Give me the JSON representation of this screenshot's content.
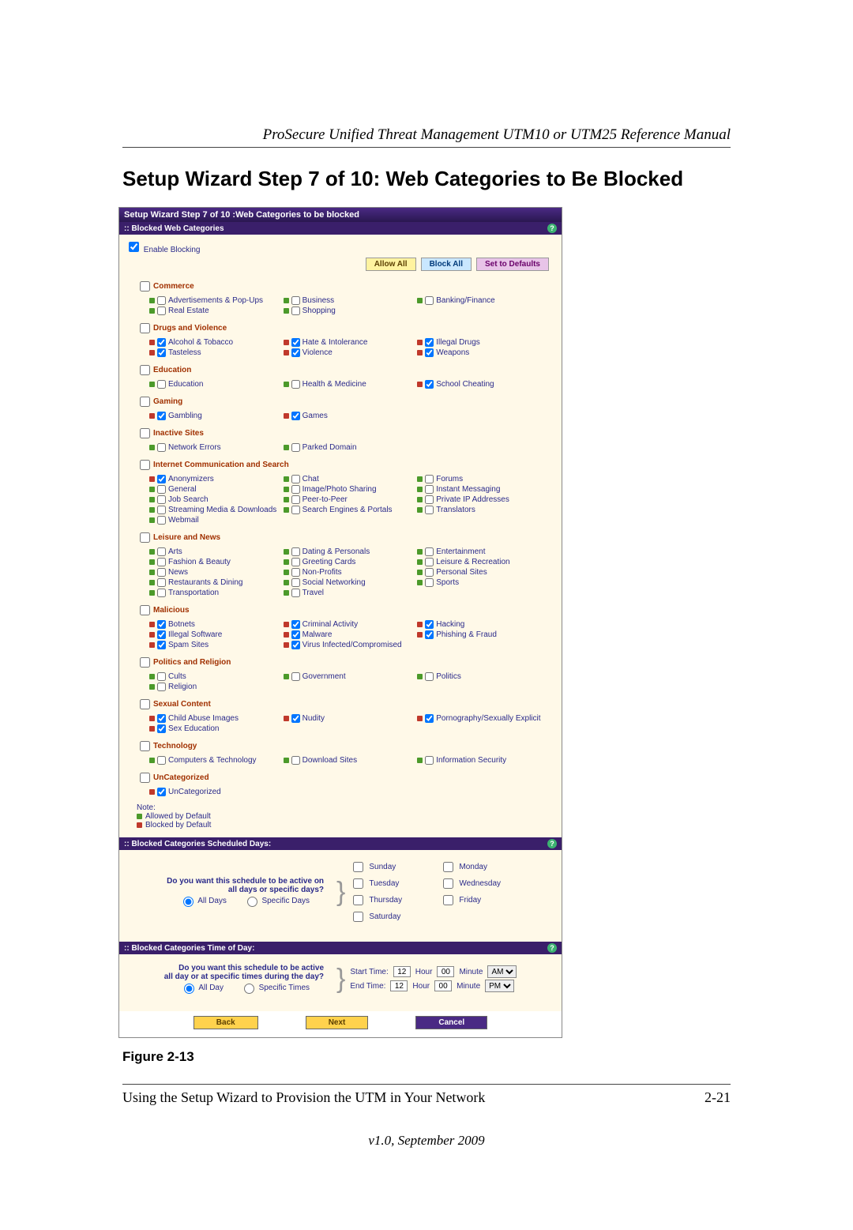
{
  "doc": {
    "header": "ProSecure Unified Threat Management UTM10 or UTM25 Reference Manual",
    "section_title": "Setup Wizard Step 7 of 10: Web Categories to Be Blocked",
    "figure_caption": "Figure 2-13",
    "footer_left": "Using the Setup Wizard to Provision the UTM in Your Network",
    "footer_right": "2-21",
    "footer_center": "v1.0, September 2009"
  },
  "wizard": {
    "title": "Setup Wizard Step 7 of 10 :Web Categories to be blocked",
    "sect_blocked": ":: Blocked Web Categories",
    "sect_sched_days": ":: Blocked Categories Scheduled Days:",
    "sect_sched_time": ":: Blocked Categories Time of Day:",
    "enable_blocking": "Enable Blocking",
    "btn_allow": "Allow All",
    "btn_block": "Block All",
    "btn_defaults": "Set to Defaults",
    "legend_note": "Note:",
    "legend_allow": "Allowed by Default",
    "legend_block": "Blocked by Default",
    "help": "?",
    "back": "Back",
    "next": "Next",
    "cancel": "Cancel"
  },
  "sched_days": {
    "question1": "Do you want this schedule to be active on",
    "question2": "all days or specific days?",
    "all": "All Days",
    "specific": "Specific Days",
    "days": [
      "Sunday",
      "Monday",
      "Tuesday",
      "Wednesday",
      "Thursday",
      "Friday",
      "Saturday"
    ]
  },
  "sched_time": {
    "question1": "Do you want this schedule to be active",
    "question2": "all day or at specific times during the day?",
    "all": "All Day",
    "specific": "Specific Times",
    "start_label": "Start Time:",
    "end_label": "End Time:",
    "hour": "12",
    "hour_lbl": "Hour",
    "min": "00",
    "min_lbl": "Minute",
    "am": "AM",
    "pm": "PM"
  },
  "categories": [
    {
      "head": "Commerce",
      "items": [
        {
          "c": "green",
          "chk": false,
          "l": "Advertisements & Pop-Ups"
        },
        {
          "c": "green",
          "chk": false,
          "l": "Business"
        },
        {
          "c": "green",
          "chk": false,
          "l": "Banking/Finance"
        },
        {
          "c": "green",
          "chk": false,
          "l": "Real Estate"
        },
        {
          "c": "green",
          "chk": false,
          "l": "Shopping"
        }
      ]
    },
    {
      "head": "Drugs and Violence",
      "items": [
        {
          "c": "red",
          "chk": true,
          "l": "Alcohol & Tobacco"
        },
        {
          "c": "red",
          "chk": true,
          "l": "Hate & Intolerance"
        },
        {
          "c": "red",
          "chk": true,
          "l": "Illegal Drugs"
        },
        {
          "c": "red",
          "chk": true,
          "l": "Tasteless"
        },
        {
          "c": "red",
          "chk": true,
          "l": "Violence"
        },
        {
          "c": "red",
          "chk": true,
          "l": "Weapons"
        }
      ]
    },
    {
      "head": "Education",
      "items": [
        {
          "c": "green",
          "chk": false,
          "l": "Education"
        },
        {
          "c": "green",
          "chk": false,
          "l": "Health & Medicine"
        },
        {
          "c": "red",
          "chk": true,
          "l": "School Cheating"
        }
      ]
    },
    {
      "head": "Gaming",
      "items": [
        {
          "c": "red",
          "chk": true,
          "l": "Gambling"
        },
        {
          "c": "red",
          "chk": true,
          "l": "Games"
        }
      ]
    },
    {
      "head": "Inactive Sites",
      "items": [
        {
          "c": "green",
          "chk": false,
          "l": "Network Errors"
        },
        {
          "c": "green",
          "chk": false,
          "l": "Parked Domain"
        }
      ]
    },
    {
      "head": "Internet Communication and Search",
      "items": [
        {
          "c": "red",
          "chk": true,
          "l": "Anonymizers"
        },
        {
          "c": "green",
          "chk": false,
          "l": "Chat"
        },
        {
          "c": "green",
          "chk": false,
          "l": "Forums"
        },
        {
          "c": "green",
          "chk": false,
          "l": "General"
        },
        {
          "c": "green",
          "chk": false,
          "l": "Image/Photo Sharing"
        },
        {
          "c": "green",
          "chk": false,
          "l": "Instant Messaging"
        },
        {
          "c": "green",
          "chk": false,
          "l": "Job Search"
        },
        {
          "c": "green",
          "chk": false,
          "l": "Peer-to-Peer"
        },
        {
          "c": "green",
          "chk": false,
          "l": "Private IP Addresses"
        },
        {
          "c": "green",
          "chk": false,
          "l": "Streaming Media & Downloads"
        },
        {
          "c": "green",
          "chk": false,
          "l": "Search Engines & Portals"
        },
        {
          "c": "green",
          "chk": false,
          "l": "Translators"
        },
        {
          "c": "green",
          "chk": false,
          "l": "Webmail"
        }
      ]
    },
    {
      "head": "Leisure and News",
      "items": [
        {
          "c": "green",
          "chk": false,
          "l": "Arts"
        },
        {
          "c": "green",
          "chk": false,
          "l": "Dating & Personals"
        },
        {
          "c": "green",
          "chk": false,
          "l": "Entertainment"
        },
        {
          "c": "green",
          "chk": false,
          "l": "Fashion & Beauty"
        },
        {
          "c": "green",
          "chk": false,
          "l": "Greeting Cards"
        },
        {
          "c": "green",
          "chk": false,
          "l": "Leisure & Recreation"
        },
        {
          "c": "green",
          "chk": false,
          "l": "News"
        },
        {
          "c": "green",
          "chk": false,
          "l": "Non-Profits"
        },
        {
          "c": "green",
          "chk": false,
          "l": "Personal Sites"
        },
        {
          "c": "green",
          "chk": false,
          "l": "Restaurants & Dining"
        },
        {
          "c": "green",
          "chk": false,
          "l": "Social Networking"
        },
        {
          "c": "green",
          "chk": false,
          "l": "Sports"
        },
        {
          "c": "green",
          "chk": false,
          "l": "Transportation"
        },
        {
          "c": "green",
          "chk": false,
          "l": "Travel"
        }
      ]
    },
    {
      "head": "Malicious",
      "items": [
        {
          "c": "red",
          "chk": true,
          "l": "Botnets"
        },
        {
          "c": "red",
          "chk": true,
          "l": "Criminal Activity"
        },
        {
          "c": "red",
          "chk": true,
          "l": "Hacking"
        },
        {
          "c": "red",
          "chk": true,
          "l": "Illegal Software"
        },
        {
          "c": "red",
          "chk": true,
          "l": "Malware"
        },
        {
          "c": "red",
          "chk": true,
          "l": "Phishing & Fraud"
        },
        {
          "c": "red",
          "chk": true,
          "l": "Spam Sites"
        },
        {
          "c": "red",
          "chk": true,
          "l": "Virus Infected/Compromised"
        }
      ]
    },
    {
      "head": "Politics and Religion",
      "items": [
        {
          "c": "green",
          "chk": false,
          "l": "Cults"
        },
        {
          "c": "green",
          "chk": false,
          "l": "Government"
        },
        {
          "c": "green",
          "chk": false,
          "l": "Politics"
        },
        {
          "c": "green",
          "chk": false,
          "l": "Religion"
        }
      ]
    },
    {
      "head": "Sexual Content",
      "items": [
        {
          "c": "red",
          "chk": true,
          "l": "Child Abuse Images"
        },
        {
          "c": "red",
          "chk": true,
          "l": "Nudity"
        },
        {
          "c": "red",
          "chk": true,
          "l": "Pornography/Sexually Explicit"
        },
        {
          "c": "red",
          "chk": true,
          "l": "Sex Education"
        }
      ]
    },
    {
      "head": "Technology",
      "items": [
        {
          "c": "green",
          "chk": false,
          "l": "Computers & Technology"
        },
        {
          "c": "green",
          "chk": false,
          "l": "Download Sites"
        },
        {
          "c": "green",
          "chk": false,
          "l": "Information Security"
        }
      ]
    },
    {
      "head": "UnCategorized",
      "items": [
        {
          "c": "red",
          "chk": true,
          "l": "UnCategorized"
        }
      ]
    }
  ]
}
